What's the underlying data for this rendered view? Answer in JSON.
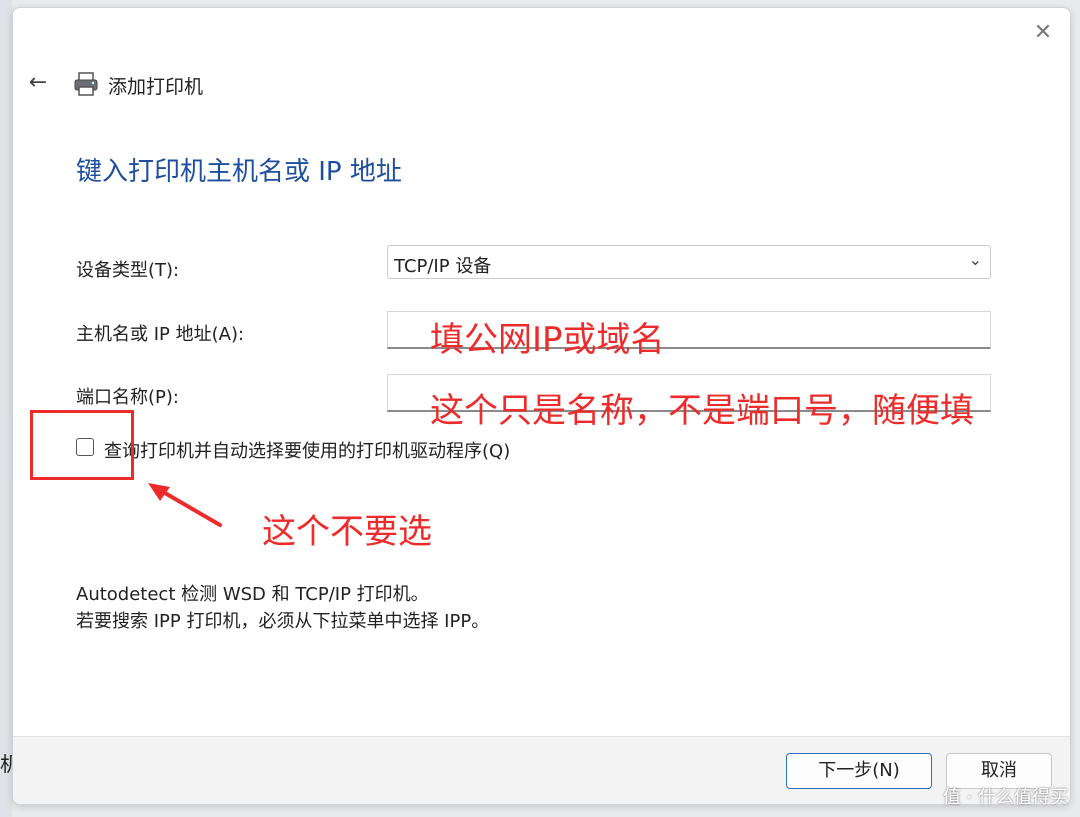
{
  "window": {
    "title": "添加打印机",
    "close_icon": "close-icon",
    "back_icon": "back-arrow-icon"
  },
  "page": {
    "heading": "键入打印机主机名或 IP 地址"
  },
  "form": {
    "device_type_label": "设备类型(T):",
    "device_type_value": "TCP/IP 设备",
    "hostname_label": "主机名或 IP 地址(A):",
    "hostname_value": "",
    "port_label": "端口名称(P):",
    "port_value": "",
    "checkbox_label": "查询打印机并自动选择要使用的打印机驱动程序(Q)",
    "checkbox_checked": false
  },
  "info": {
    "line1": "Autodetect 检测 WSD 和 TCP/IP 打印机。",
    "line2": "若要搜索 IPP 打印机，必须从下拉菜单中选择 IPP。"
  },
  "buttons": {
    "next": "下一步(N)",
    "cancel": "取消"
  },
  "annotations": {
    "hostname_note": "填公网IP或域名",
    "port_note": "这个只是名称，不是端口号，随便填",
    "checkbox_note": "这个不要选",
    "color": "#ee2b2b"
  },
  "background": {
    "partial_char": "机"
  },
  "watermark": "值 · 什么值得买"
}
